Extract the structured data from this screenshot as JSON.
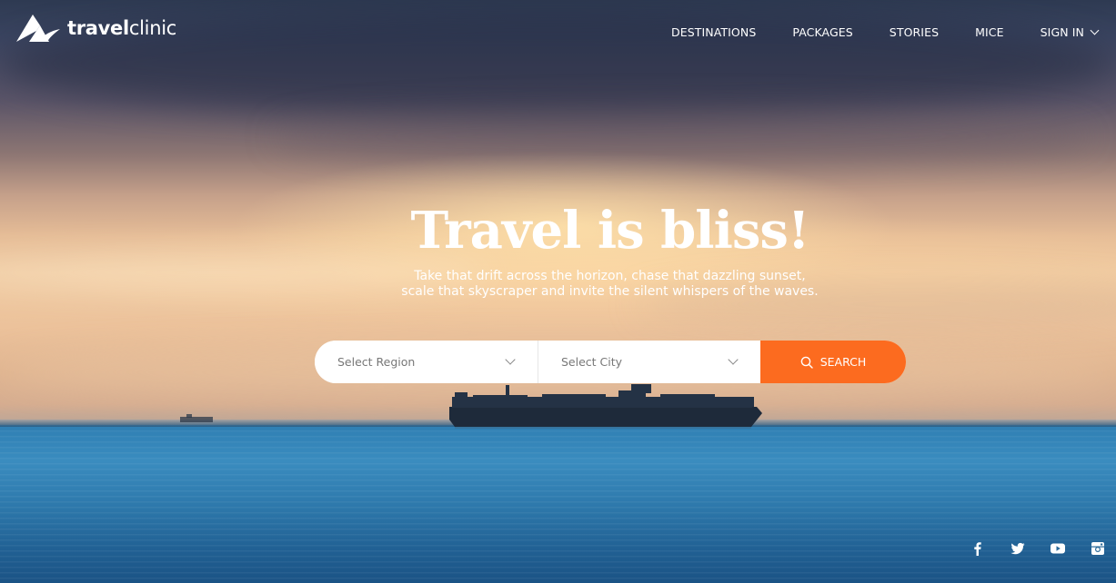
{
  "brand": {
    "name_bold": "travel",
    "name_light": "clinic"
  },
  "nav": {
    "items": [
      {
        "label": "DESTINATIONS"
      },
      {
        "label": "PACKAGES"
      },
      {
        "label": "STORIES"
      },
      {
        "label": "MICE"
      },
      {
        "label": "SIGN IN"
      }
    ]
  },
  "hero": {
    "title": "Travel is bliss!",
    "subtitle_line1": "Take that drift across the horizon, chase that dazzling sunset,",
    "subtitle_line2": "scale that skyscraper and invite the silent whispers of the waves."
  },
  "search": {
    "region_value": "Select Region",
    "city_value": "Select City",
    "button_label": "SEARCH",
    "button_color": "#fc6b1f"
  },
  "social": {
    "icons": [
      "facebook-icon",
      "twitter-icon",
      "youtube-icon",
      "instagram-icon"
    ]
  }
}
